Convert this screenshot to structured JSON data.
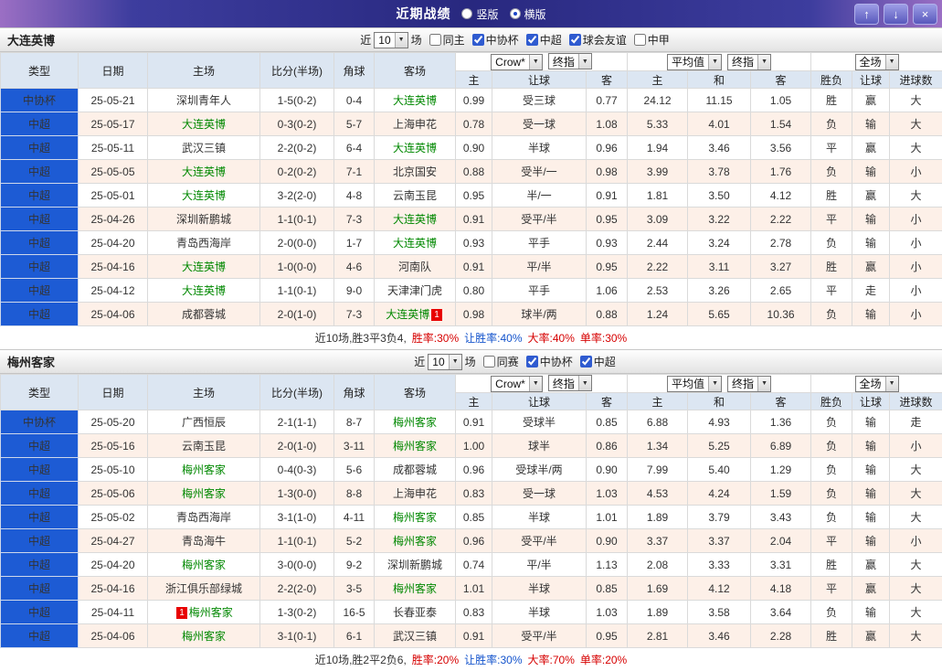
{
  "titlebar": {
    "title": "近期战绩",
    "options": [
      {
        "label": "竖版",
        "selected": false
      },
      {
        "label": "横版",
        "selected": true
      }
    ],
    "buttons": {
      "up": "↑",
      "down": "↓",
      "close": "×"
    }
  },
  "filter_labels": {
    "near": "近",
    "games": "场"
  },
  "table_header": {
    "static_cols": [
      "类型",
      "日期",
      "主场",
      "比分(半场)",
      "角球",
      "客场"
    ],
    "odds_dropdowns_1": [
      "Crow*",
      "终指"
    ],
    "odds_cols_1": [
      "主",
      "让球",
      "客"
    ],
    "odds_dropdowns_2": [
      "平均值",
      "终指"
    ],
    "odds_cols_2": [
      "主",
      "和",
      "客"
    ],
    "result_dropdown": "全场",
    "result_cols": [
      "胜负",
      "让球",
      "进球数"
    ]
  },
  "colors": {
    "focus_team": "#008800",
    "score": "#d60000",
    "type_cell": "#1d5bd4",
    "zebra": "#fdf0e8"
  },
  "sections": [
    {
      "team": "大连英博",
      "near_count": "10",
      "filters": [
        {
          "label": "同主",
          "checked": false
        },
        {
          "label": "中协杯",
          "checked": true
        },
        {
          "label": "中超",
          "checked": true
        },
        {
          "label": "球会友谊",
          "checked": true
        },
        {
          "label": "中甲",
          "checked": false
        }
      ],
      "rows": [
        {
          "type": "中协杯",
          "date": "25-05-21",
          "home": "深圳青年人",
          "home_focus": false,
          "score": "1-5(0-2)",
          "corner": "0-4",
          "away": "大连英博",
          "away_focus": true,
          "odds": [
            "0.99",
            "受三球",
            "0.77"
          ],
          "avg": [
            "24.12",
            "11.15",
            "1.05"
          ],
          "results": [
            {
              "t": "胜",
              "c": "red"
            },
            {
              "t": "赢",
              "c": "red"
            },
            {
              "t": "大",
              "c": "red"
            }
          ]
        },
        {
          "type": "中超",
          "date": "25-05-17",
          "home": "大连英博",
          "home_focus": true,
          "score": "0-3(0-2)",
          "corner": "5-7",
          "away": "上海申花",
          "away_focus": false,
          "odds": [
            "0.78",
            "受一球",
            "1.08"
          ],
          "avg": [
            "5.33",
            "4.01",
            "1.54"
          ],
          "results": [
            {
              "t": "负",
              "c": "blue"
            },
            {
              "t": "输",
              "c": "blue"
            },
            {
              "t": "大",
              "c": "red"
            }
          ]
        },
        {
          "type": "中超",
          "date": "25-05-11",
          "home": "武汉三镇",
          "home_focus": false,
          "score": "2-2(0-2)",
          "corner": "6-4",
          "away": "大连英博",
          "away_focus": true,
          "odds": [
            "0.90",
            "半球",
            "0.96"
          ],
          "avg": [
            "1.94",
            "3.46",
            "3.56"
          ],
          "results": [
            {
              "t": "平",
              "c": "green"
            },
            {
              "t": "赢",
              "c": "red"
            },
            {
              "t": "大",
              "c": "red"
            }
          ]
        },
        {
          "type": "中超",
          "date": "25-05-05",
          "home": "大连英博",
          "home_focus": true,
          "score": "0-2(0-2)",
          "corner": "7-1",
          "away": "北京国安",
          "away_focus": false,
          "odds": [
            "0.88",
            "受半/一",
            "0.98"
          ],
          "avg": [
            "3.99",
            "3.78",
            "1.76"
          ],
          "results": [
            {
              "t": "负",
              "c": "blue"
            },
            {
              "t": "输",
              "c": "blue"
            },
            {
              "t": "小",
              "c": "blue"
            }
          ]
        },
        {
          "type": "中超",
          "date": "25-05-01",
          "home": "大连英博",
          "home_focus": true,
          "score": "3-2(2-0)",
          "corner": "4-8",
          "away": "云南玉昆",
          "away_focus": false,
          "odds": [
            "0.95",
            "半/一",
            "0.91"
          ],
          "avg": [
            "1.81",
            "3.50",
            "4.12"
          ],
          "results": [
            {
              "t": "胜",
              "c": "red"
            },
            {
              "t": "赢",
              "c": "red"
            },
            {
              "t": "大",
              "c": "red"
            }
          ]
        },
        {
          "type": "中超",
          "date": "25-04-26",
          "home": "深圳新鹏城",
          "home_focus": false,
          "score": "1-1(0-1)",
          "corner": "7-3",
          "away": "大连英博",
          "away_focus": true,
          "odds": [
            "0.91",
            "受平/半",
            "0.95"
          ],
          "avg": [
            "3.09",
            "3.22",
            "2.22"
          ],
          "results": [
            {
              "t": "平",
              "c": "green"
            },
            {
              "t": "输",
              "c": "blue"
            },
            {
              "t": "小",
              "c": "blue"
            }
          ]
        },
        {
          "type": "中超",
          "date": "25-04-20",
          "home": "青岛西海岸",
          "home_focus": false,
          "score": "2-0(0-0)",
          "corner": "1-7",
          "away": "大连英博",
          "away_focus": true,
          "odds": [
            "0.93",
            "平手",
            "0.93"
          ],
          "avg": [
            "2.44",
            "3.24",
            "2.78"
          ],
          "results": [
            {
              "t": "负",
              "c": "blue"
            },
            {
              "t": "输",
              "c": "blue"
            },
            {
              "t": "小",
              "c": "blue"
            }
          ]
        },
        {
          "type": "中超",
          "date": "25-04-16",
          "home": "大连英博",
          "home_focus": true,
          "score": "1-0(0-0)",
          "corner": "4-6",
          "away": "河南队",
          "away_focus": false,
          "odds": [
            "0.91",
            "平/半",
            "0.95"
          ],
          "avg": [
            "2.22",
            "3.11",
            "3.27"
          ],
          "results": [
            {
              "t": "胜",
              "c": "red"
            },
            {
              "t": "赢",
              "c": "red"
            },
            {
              "t": "小",
              "c": "blue"
            }
          ]
        },
        {
          "type": "中超",
          "date": "25-04-12",
          "home": "大连英博",
          "home_focus": true,
          "score": "1-1(0-1)",
          "corner": "9-0",
          "away": "天津津门虎",
          "away_focus": false,
          "odds": [
            "0.80",
            "平手",
            "1.06"
          ],
          "avg": [
            "2.53",
            "3.26",
            "2.65"
          ],
          "results": [
            {
              "t": "平",
              "c": "green"
            },
            {
              "t": "走",
              "c": "green"
            },
            {
              "t": "小",
              "c": "blue"
            }
          ]
        },
        {
          "type": "中超",
          "date": "25-04-06",
          "home": "成都蓉城",
          "home_focus": false,
          "score": "2-0(1-0)",
          "corner": "7-3",
          "away": "大连英博",
          "away_focus": true,
          "away_badge": {
            "text": "1",
            "pos": "after"
          },
          "odds": [
            "0.98",
            "球半/两",
            "0.88"
          ],
          "avg": [
            "1.24",
            "5.65",
            "10.36"
          ],
          "results": [
            {
              "t": "负",
              "c": "blue"
            },
            {
              "t": "输",
              "c": "blue"
            },
            {
              "t": "小",
              "c": "blue"
            }
          ]
        }
      ],
      "summary": [
        {
          "text": "近10场,胜3平3负4,",
          "color": "dark"
        },
        {
          "text": "胜率:30%",
          "color": "red"
        },
        {
          "text": "让胜率:40%",
          "color": "blue"
        },
        {
          "text": "大率:40%",
          "color": "red"
        },
        {
          "text": "单率:30%",
          "color": "red"
        }
      ]
    },
    {
      "team": "梅州客家",
      "near_count": "10",
      "filters": [
        {
          "label": "同赛",
          "checked": false
        },
        {
          "label": "中协杯",
          "checked": true
        },
        {
          "label": "中超",
          "checked": true
        }
      ],
      "rows": [
        {
          "type": "中协杯",
          "date": "25-05-20",
          "home": "广西恒辰",
          "home_focus": false,
          "score": "2-1(1-1)",
          "corner": "8-7",
          "away": "梅州客家",
          "away_focus": true,
          "odds": [
            "0.91",
            "受球半",
            "0.85"
          ],
          "avg": [
            "6.88",
            "4.93",
            "1.36"
          ],
          "results": [
            {
              "t": "负",
              "c": "blue"
            },
            {
              "t": "输",
              "c": "blue"
            },
            {
              "t": "走",
              "c": "green"
            }
          ]
        },
        {
          "type": "中超",
          "date": "25-05-16",
          "home": "云南玉昆",
          "home_focus": false,
          "score": "2-0(1-0)",
          "corner": "3-11",
          "away": "梅州客家",
          "away_focus": true,
          "odds": [
            "1.00",
            "球半",
            "0.86"
          ],
          "avg": [
            "1.34",
            "5.25",
            "6.89"
          ],
          "results": [
            {
              "t": "负",
              "c": "blue"
            },
            {
              "t": "输",
              "c": "blue"
            },
            {
              "t": "小",
              "c": "blue"
            }
          ]
        },
        {
          "type": "中超",
          "date": "25-05-10",
          "home": "梅州客家",
          "home_focus": true,
          "score": "0-4(0-3)",
          "corner": "5-6",
          "away": "成都蓉城",
          "away_focus": false,
          "odds": [
            "0.96",
            "受球半/两",
            "0.90"
          ],
          "avg": [
            "7.99",
            "5.40",
            "1.29"
          ],
          "results": [
            {
              "t": "负",
              "c": "blue"
            },
            {
              "t": "输",
              "c": "blue"
            },
            {
              "t": "大",
              "c": "red"
            }
          ]
        },
        {
          "type": "中超",
          "date": "25-05-06",
          "home": "梅州客家",
          "home_focus": true,
          "score": "1-3(0-0)",
          "corner": "8-8",
          "away": "上海申花",
          "away_focus": false,
          "odds": [
            "0.83",
            "受一球",
            "1.03"
          ],
          "avg": [
            "4.53",
            "4.24",
            "1.59"
          ],
          "results": [
            {
              "t": "负",
              "c": "blue"
            },
            {
              "t": "输",
              "c": "blue"
            },
            {
              "t": "大",
              "c": "red"
            }
          ]
        },
        {
          "type": "中超",
          "date": "25-05-02",
          "home": "青岛西海岸",
          "home_focus": false,
          "score": "3-1(1-0)",
          "corner": "4-11",
          "away": "梅州客家",
          "away_focus": true,
          "odds": [
            "0.85",
            "半球",
            "1.01"
          ],
          "avg": [
            "1.89",
            "3.79",
            "3.43"
          ],
          "results": [
            {
              "t": "负",
              "c": "blue"
            },
            {
              "t": "输",
              "c": "blue"
            },
            {
              "t": "大",
              "c": "red"
            }
          ]
        },
        {
          "type": "中超",
          "date": "25-04-27",
          "home": "青岛海牛",
          "home_focus": false,
          "score": "1-1(0-1)",
          "corner": "5-2",
          "away": "梅州客家",
          "away_focus": true,
          "odds": [
            "0.96",
            "受平/半",
            "0.90"
          ],
          "avg": [
            "3.37",
            "3.37",
            "2.04"
          ],
          "results": [
            {
              "t": "平",
              "c": "green"
            },
            {
              "t": "输",
              "c": "blue"
            },
            {
              "t": "小",
              "c": "blue"
            }
          ]
        },
        {
          "type": "中超",
          "date": "25-04-20",
          "home": "梅州客家",
          "home_focus": true,
          "score": "3-0(0-0)",
          "corner": "9-2",
          "away": "深圳新鹏城",
          "away_focus": false,
          "odds": [
            "0.74",
            "平/半",
            "1.13"
          ],
          "avg": [
            "2.08",
            "3.33",
            "3.31"
          ],
          "results": [
            {
              "t": "胜",
              "c": "red"
            },
            {
              "t": "赢",
              "c": "red"
            },
            {
              "t": "大",
              "c": "red"
            }
          ]
        },
        {
          "type": "中超",
          "date": "25-04-16",
          "home": "浙江俱乐部绿城",
          "home_focus": false,
          "score": "2-2(2-0)",
          "corner": "3-5",
          "away": "梅州客家",
          "away_focus": true,
          "odds": [
            "1.01",
            "半球",
            "0.85"
          ],
          "avg": [
            "1.69",
            "4.12",
            "4.18"
          ],
          "results": [
            {
              "t": "平",
              "c": "green"
            },
            {
              "t": "赢",
              "c": "red"
            },
            {
              "t": "大",
              "c": "red"
            }
          ]
        },
        {
          "type": "中超",
          "date": "25-04-11",
          "home": "梅州客家",
          "home_focus": true,
          "home_badge": {
            "text": "1",
            "pos": "before"
          },
          "score": "1-3(0-2)",
          "corner": "16-5",
          "away": "长春亚泰",
          "away_focus": false,
          "odds": [
            "0.83",
            "半球",
            "1.03"
          ],
          "avg": [
            "1.89",
            "3.58",
            "3.64"
          ],
          "results": [
            {
              "t": "负",
              "c": "blue"
            },
            {
              "t": "输",
              "c": "blue"
            },
            {
              "t": "大",
              "c": "red"
            }
          ]
        },
        {
          "type": "中超",
          "date": "25-04-06",
          "home": "梅州客家",
          "home_focus": true,
          "score": "3-1(0-1)",
          "corner": "6-1",
          "away": "武汉三镇",
          "away_focus": false,
          "odds": [
            "0.91",
            "受平/半",
            "0.95"
          ],
          "avg": [
            "2.81",
            "3.46",
            "2.28"
          ],
          "results": [
            {
              "t": "胜",
              "c": "red"
            },
            {
              "t": "赢",
              "c": "red"
            },
            {
              "t": "大",
              "c": "red"
            }
          ]
        }
      ],
      "summary": [
        {
          "text": "近10场,胜2平2负6,",
          "color": "dark"
        },
        {
          "text": "胜率:20%",
          "color": "red"
        },
        {
          "text": "让胜率:30%",
          "color": "blue"
        },
        {
          "text": "大率:70%",
          "color": "red"
        },
        {
          "text": "单率:20%",
          "color": "red"
        }
      ]
    }
  ]
}
